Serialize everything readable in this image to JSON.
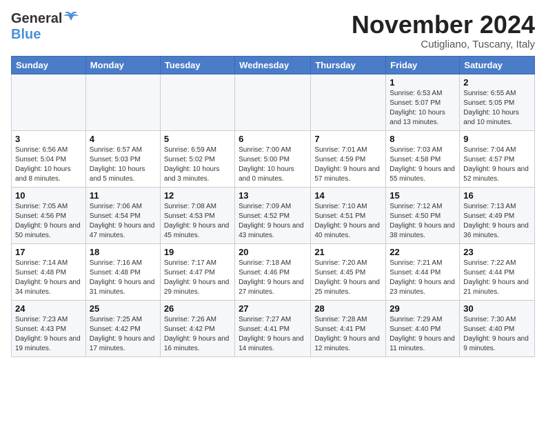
{
  "logo": {
    "general": "General",
    "blue": "Blue"
  },
  "header": {
    "month": "November 2024",
    "location": "Cutigliano, Tuscany, Italy"
  },
  "days_of_week": [
    "Sunday",
    "Monday",
    "Tuesday",
    "Wednesday",
    "Thursday",
    "Friday",
    "Saturday"
  ],
  "weeks": [
    [
      {
        "day": "",
        "info": ""
      },
      {
        "day": "",
        "info": ""
      },
      {
        "day": "",
        "info": ""
      },
      {
        "day": "",
        "info": ""
      },
      {
        "day": "",
        "info": ""
      },
      {
        "day": "1",
        "info": "Sunrise: 6:53 AM\nSunset: 5:07 PM\nDaylight: 10 hours and 13 minutes."
      },
      {
        "day": "2",
        "info": "Sunrise: 6:55 AM\nSunset: 5:05 PM\nDaylight: 10 hours and 10 minutes."
      }
    ],
    [
      {
        "day": "3",
        "info": "Sunrise: 6:56 AM\nSunset: 5:04 PM\nDaylight: 10 hours and 8 minutes."
      },
      {
        "day": "4",
        "info": "Sunrise: 6:57 AM\nSunset: 5:03 PM\nDaylight: 10 hours and 5 minutes."
      },
      {
        "day": "5",
        "info": "Sunrise: 6:59 AM\nSunset: 5:02 PM\nDaylight: 10 hours and 3 minutes."
      },
      {
        "day": "6",
        "info": "Sunrise: 7:00 AM\nSunset: 5:00 PM\nDaylight: 10 hours and 0 minutes."
      },
      {
        "day": "7",
        "info": "Sunrise: 7:01 AM\nSunset: 4:59 PM\nDaylight: 9 hours and 57 minutes."
      },
      {
        "day": "8",
        "info": "Sunrise: 7:03 AM\nSunset: 4:58 PM\nDaylight: 9 hours and 55 minutes."
      },
      {
        "day": "9",
        "info": "Sunrise: 7:04 AM\nSunset: 4:57 PM\nDaylight: 9 hours and 52 minutes."
      }
    ],
    [
      {
        "day": "10",
        "info": "Sunrise: 7:05 AM\nSunset: 4:56 PM\nDaylight: 9 hours and 50 minutes."
      },
      {
        "day": "11",
        "info": "Sunrise: 7:06 AM\nSunset: 4:54 PM\nDaylight: 9 hours and 47 minutes."
      },
      {
        "day": "12",
        "info": "Sunrise: 7:08 AM\nSunset: 4:53 PM\nDaylight: 9 hours and 45 minutes."
      },
      {
        "day": "13",
        "info": "Sunrise: 7:09 AM\nSunset: 4:52 PM\nDaylight: 9 hours and 43 minutes."
      },
      {
        "day": "14",
        "info": "Sunrise: 7:10 AM\nSunset: 4:51 PM\nDaylight: 9 hours and 40 minutes."
      },
      {
        "day": "15",
        "info": "Sunrise: 7:12 AM\nSunset: 4:50 PM\nDaylight: 9 hours and 38 minutes."
      },
      {
        "day": "16",
        "info": "Sunrise: 7:13 AM\nSunset: 4:49 PM\nDaylight: 9 hours and 36 minutes."
      }
    ],
    [
      {
        "day": "17",
        "info": "Sunrise: 7:14 AM\nSunset: 4:48 PM\nDaylight: 9 hours and 34 minutes."
      },
      {
        "day": "18",
        "info": "Sunrise: 7:16 AM\nSunset: 4:48 PM\nDaylight: 9 hours and 31 minutes."
      },
      {
        "day": "19",
        "info": "Sunrise: 7:17 AM\nSunset: 4:47 PM\nDaylight: 9 hours and 29 minutes."
      },
      {
        "day": "20",
        "info": "Sunrise: 7:18 AM\nSunset: 4:46 PM\nDaylight: 9 hours and 27 minutes."
      },
      {
        "day": "21",
        "info": "Sunrise: 7:20 AM\nSunset: 4:45 PM\nDaylight: 9 hours and 25 minutes."
      },
      {
        "day": "22",
        "info": "Sunrise: 7:21 AM\nSunset: 4:44 PM\nDaylight: 9 hours and 23 minutes."
      },
      {
        "day": "23",
        "info": "Sunrise: 7:22 AM\nSunset: 4:44 PM\nDaylight: 9 hours and 21 minutes."
      }
    ],
    [
      {
        "day": "24",
        "info": "Sunrise: 7:23 AM\nSunset: 4:43 PM\nDaylight: 9 hours and 19 minutes."
      },
      {
        "day": "25",
        "info": "Sunrise: 7:25 AM\nSunset: 4:42 PM\nDaylight: 9 hours and 17 minutes."
      },
      {
        "day": "26",
        "info": "Sunrise: 7:26 AM\nSunset: 4:42 PM\nDaylight: 9 hours and 16 minutes."
      },
      {
        "day": "27",
        "info": "Sunrise: 7:27 AM\nSunset: 4:41 PM\nDaylight: 9 hours and 14 minutes."
      },
      {
        "day": "28",
        "info": "Sunrise: 7:28 AM\nSunset: 4:41 PM\nDaylight: 9 hours and 12 minutes."
      },
      {
        "day": "29",
        "info": "Sunrise: 7:29 AM\nSunset: 4:40 PM\nDaylight: 9 hours and 11 minutes."
      },
      {
        "day": "30",
        "info": "Sunrise: 7:30 AM\nSunset: 4:40 PM\nDaylight: 9 hours and 9 minutes."
      }
    ]
  ]
}
